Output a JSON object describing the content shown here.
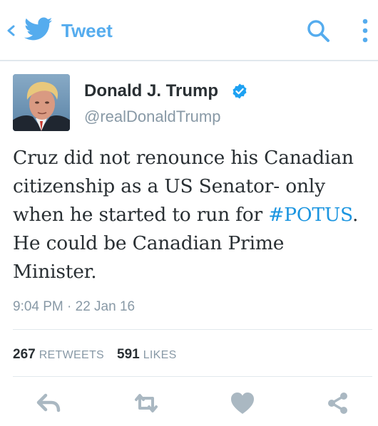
{
  "appbar": {
    "title": "Tweet",
    "icons": [
      "chevron-left-icon",
      "twitter-bird-icon",
      "search-icon",
      "more-vertical-icon"
    ]
  },
  "colors": {
    "accent": "#55acee",
    "hashtag": "#1b95e0",
    "text": "#292f33",
    "muted": "#8899a6",
    "divider": "#e1e8ed",
    "action_icon": "#aab8c2"
  },
  "tweet": {
    "author": {
      "name": "Donald J. Trump",
      "handle": "@realDonaldTrump",
      "verified": true
    },
    "text_before": "Cruz did not renounce his Canadian citizenship as a US Senator- only when he started to run for ",
    "hashtag": "#POTUS",
    "text_after": ". He could be Canadian Prime Minister.",
    "timestamp": "9:04 PM · 22 Jan 16",
    "retweets": {
      "count": "267",
      "label": "RETWEETS"
    },
    "likes": {
      "count": "591",
      "label": "LIKES"
    }
  },
  "actions": [
    "reply-icon",
    "retweet-icon",
    "heart-icon",
    "share-icon"
  ]
}
